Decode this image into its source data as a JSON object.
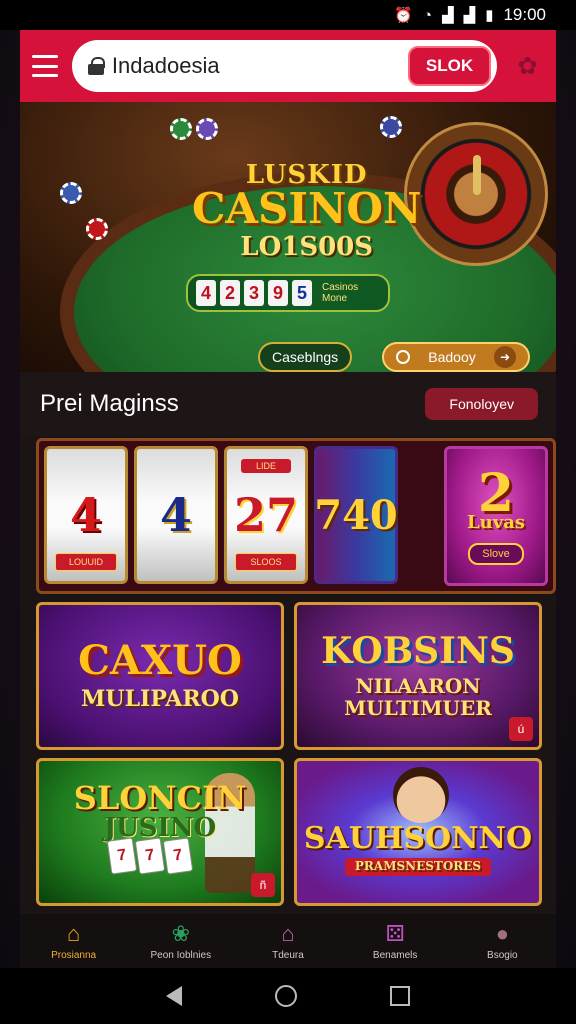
{
  "status": {
    "time": "19:00"
  },
  "topbar": {
    "search_value": "Indadoesia",
    "slot_button": "SLOK"
  },
  "hero": {
    "title_line1": "LUSKID",
    "title_line2": "CASINON",
    "title_line3": "LO1S00S",
    "digits": [
      "4",
      "2",
      "3",
      "9",
      "5"
    ],
    "caption": "Casinos Mone",
    "button_left": "Caseblngs",
    "button_right": "Badooy"
  },
  "section": {
    "title": "Prei Maginss",
    "button": "Fonoloyev"
  },
  "slots": {
    "reels": [
      {
        "num": "4",
        "tag": "LOUUID"
      },
      {
        "num": "4",
        "tag": ""
      },
      {
        "num": "27",
        "tag": "SLOOS",
        "tagtop": "LIDE"
      },
      {
        "num": "740",
        "tag": ""
      }
    ],
    "promo": {
      "big": "2",
      "sub": "Luvas",
      "pill": "Slove"
    }
  },
  "games": [
    {
      "t1": "CAXUO",
      "t2": "MULIPAROO"
    },
    {
      "t1": "KOBSINS",
      "t2": "NILAARON MULTIMUER",
      "badge": "ú"
    },
    {
      "t1": "SLONCIN",
      "t2": "JUSINO",
      "badge": "ñ",
      "cards": [
        "7",
        "7",
        "7"
      ]
    },
    {
      "t1": "SAUHSONNO",
      "t2": "PRAMSNESTORES"
    }
  ],
  "bottomnav": [
    {
      "label": "Prosianna",
      "icon": "home-icon",
      "color": "#f0a020"
    },
    {
      "label": "Peon Ioblnies",
      "icon": "gift-icon",
      "color": "#2aa060"
    },
    {
      "label": "Tdeura",
      "icon": "house-outline-icon",
      "color": "#c060b0"
    },
    {
      "label": "Benamels",
      "icon": "dice-icon",
      "color": "#c050c0"
    },
    {
      "label": "Bsogio",
      "icon": "user-icon",
      "color": "#a07080"
    }
  ]
}
